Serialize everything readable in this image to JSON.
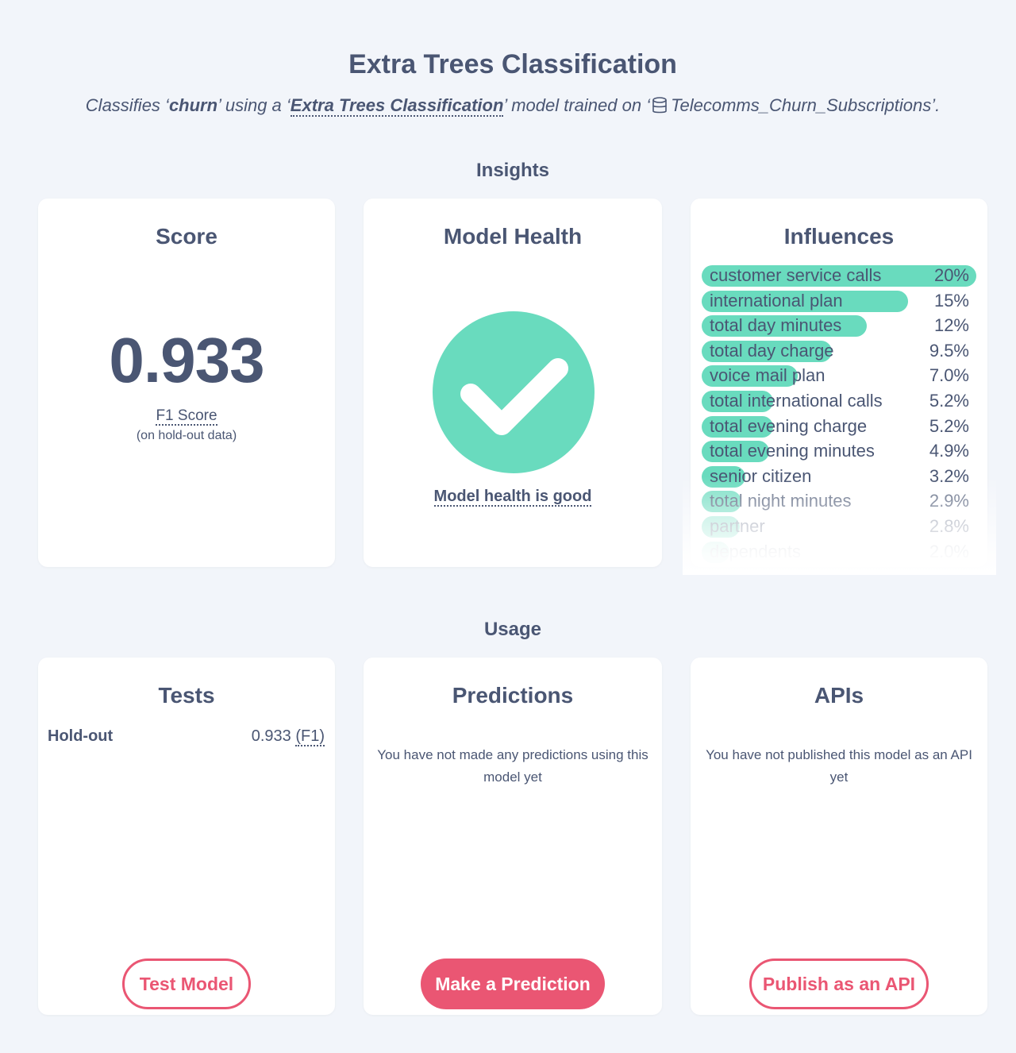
{
  "header": {
    "title": "Extra Trees Classification",
    "subtitle_prefix": "Classifies ‘",
    "target": "churn",
    "subtitle_mid1": "’ using a ‘",
    "model_name": "Extra Trees Classification",
    "subtitle_mid2": "’ model trained on ‘",
    "dataset_icon": "database-icon",
    "dataset": "Telecomms_Churn_Subscriptions",
    "subtitle_suffix": "’."
  },
  "insights": {
    "heading": "Insights",
    "score": {
      "title": "Score",
      "value": "0.933",
      "metric": "F1 Score",
      "note": "(on hold-out data)"
    },
    "health": {
      "title": "Model Health",
      "icon": "checkmark-icon",
      "label": "Model health is good",
      "color": "#69dbbe"
    },
    "influences": {
      "title": "Influences",
      "bar_color": "#69dbbe",
      "items": [
        {
          "name": "customer service calls",
          "value": "20%",
          "fraction": 0.2
        },
        {
          "name": "international plan",
          "value": "15%",
          "fraction": 0.15
        },
        {
          "name": "total day minutes",
          "value": "12%",
          "fraction": 0.12
        },
        {
          "name": "total day charge",
          "value": "9.5%",
          "fraction": 0.095
        },
        {
          "name": "voice mail plan",
          "value": "7.0%",
          "fraction": 0.07
        },
        {
          "name": "total international calls",
          "value": "5.2%",
          "fraction": 0.052
        },
        {
          "name": "total evening charge",
          "value": "5.2%",
          "fraction": 0.052
        },
        {
          "name": "total evening minutes",
          "value": "4.9%",
          "fraction": 0.049
        },
        {
          "name": "senior citizen",
          "value": "3.2%",
          "fraction": 0.032
        },
        {
          "name": "total night minutes",
          "value": "2.9%",
          "fraction": 0.029
        },
        {
          "name": "partner",
          "value": "2.8%",
          "fraction": 0.028
        },
        {
          "name": "dependents",
          "value": "2.0%",
          "fraction": 0.02
        }
      ]
    }
  },
  "usage": {
    "heading": "Usage",
    "tests": {
      "title": "Tests",
      "row_label": "Hold-out",
      "row_value": "0.933",
      "row_metric": "(F1)",
      "button": "Test Model"
    },
    "predictions": {
      "title": "Predictions",
      "message": "You have not made any predictions using this model yet",
      "button": "Make a Prediction"
    },
    "apis": {
      "title": "APIs",
      "message": "You have not published this model as an API yet",
      "button": "Publish as an API"
    }
  },
  "colors": {
    "accent": "#ea5673",
    "text": "#4a5673",
    "background": "#f2f5fa"
  }
}
